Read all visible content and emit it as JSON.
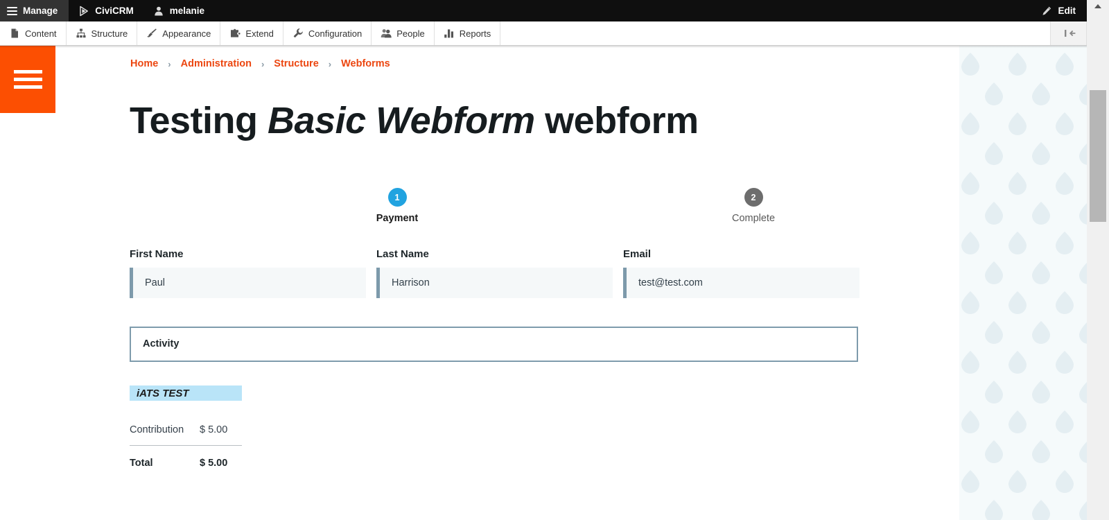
{
  "admin_bar": {
    "manage": "Manage",
    "civicrm": "CiviCRM",
    "user": "melanie",
    "edit": "Edit",
    "icons": {
      "hamburger": "hamburger-icon",
      "civicrm_logo": "civicrm-logo-icon",
      "user": "user-icon",
      "pencil": "pencil-icon"
    }
  },
  "toolbar": {
    "items": [
      {
        "label": "Content",
        "icon": "document-icon"
      },
      {
        "label": "Structure",
        "icon": "sitemap-icon"
      },
      {
        "label": "Appearance",
        "icon": "paintbrush-icon"
      },
      {
        "label": "Extend",
        "icon": "puzzle-piece-icon"
      },
      {
        "label": "Configuration",
        "icon": "wrench-icon"
      },
      {
        "label": "People",
        "icon": "people-icon"
      },
      {
        "label": "Reports",
        "icon": "bar-chart-icon"
      }
    ],
    "collapse_icon": "collapse-left-icon"
  },
  "sidebar": {
    "toggle_icon": "hamburger-icon"
  },
  "breadcrumb": {
    "items": [
      "Home",
      "Administration",
      "Structure",
      "Webforms"
    ],
    "separator": "›"
  },
  "page": {
    "title_prefix": "Testing ",
    "title_emphasis": "Basic Webform",
    "title_suffix": " webform"
  },
  "steps": [
    {
      "number": "1",
      "label": "Payment",
      "state": "active"
    },
    {
      "number": "2",
      "label": "Complete",
      "state": "inactive"
    }
  ],
  "form": {
    "fields": [
      {
        "label": "First Name",
        "value": "Paul",
        "placeholder": ""
      },
      {
        "label": "Last Name",
        "value": "Harrison",
        "placeholder": ""
      },
      {
        "label": "Email",
        "value": "test@test.com",
        "placeholder": ""
      }
    ],
    "activity_legend": "Activity",
    "processor_banner": "iATS TEST"
  },
  "totals": {
    "line_label": "Contribution",
    "line_value": "$ 5.00",
    "total_label": "Total",
    "total_value": "$ 5.00"
  },
  "colors": {
    "brand_orange": "#fc4f02",
    "breadcrumb_link": "#ec4610",
    "step_active": "#21a3e0",
    "step_inactive": "#6d6d6d",
    "field_accent": "#7d9aab",
    "banner_highlight": "#b9e4f8",
    "admin_bar": "#0f0f0f"
  }
}
